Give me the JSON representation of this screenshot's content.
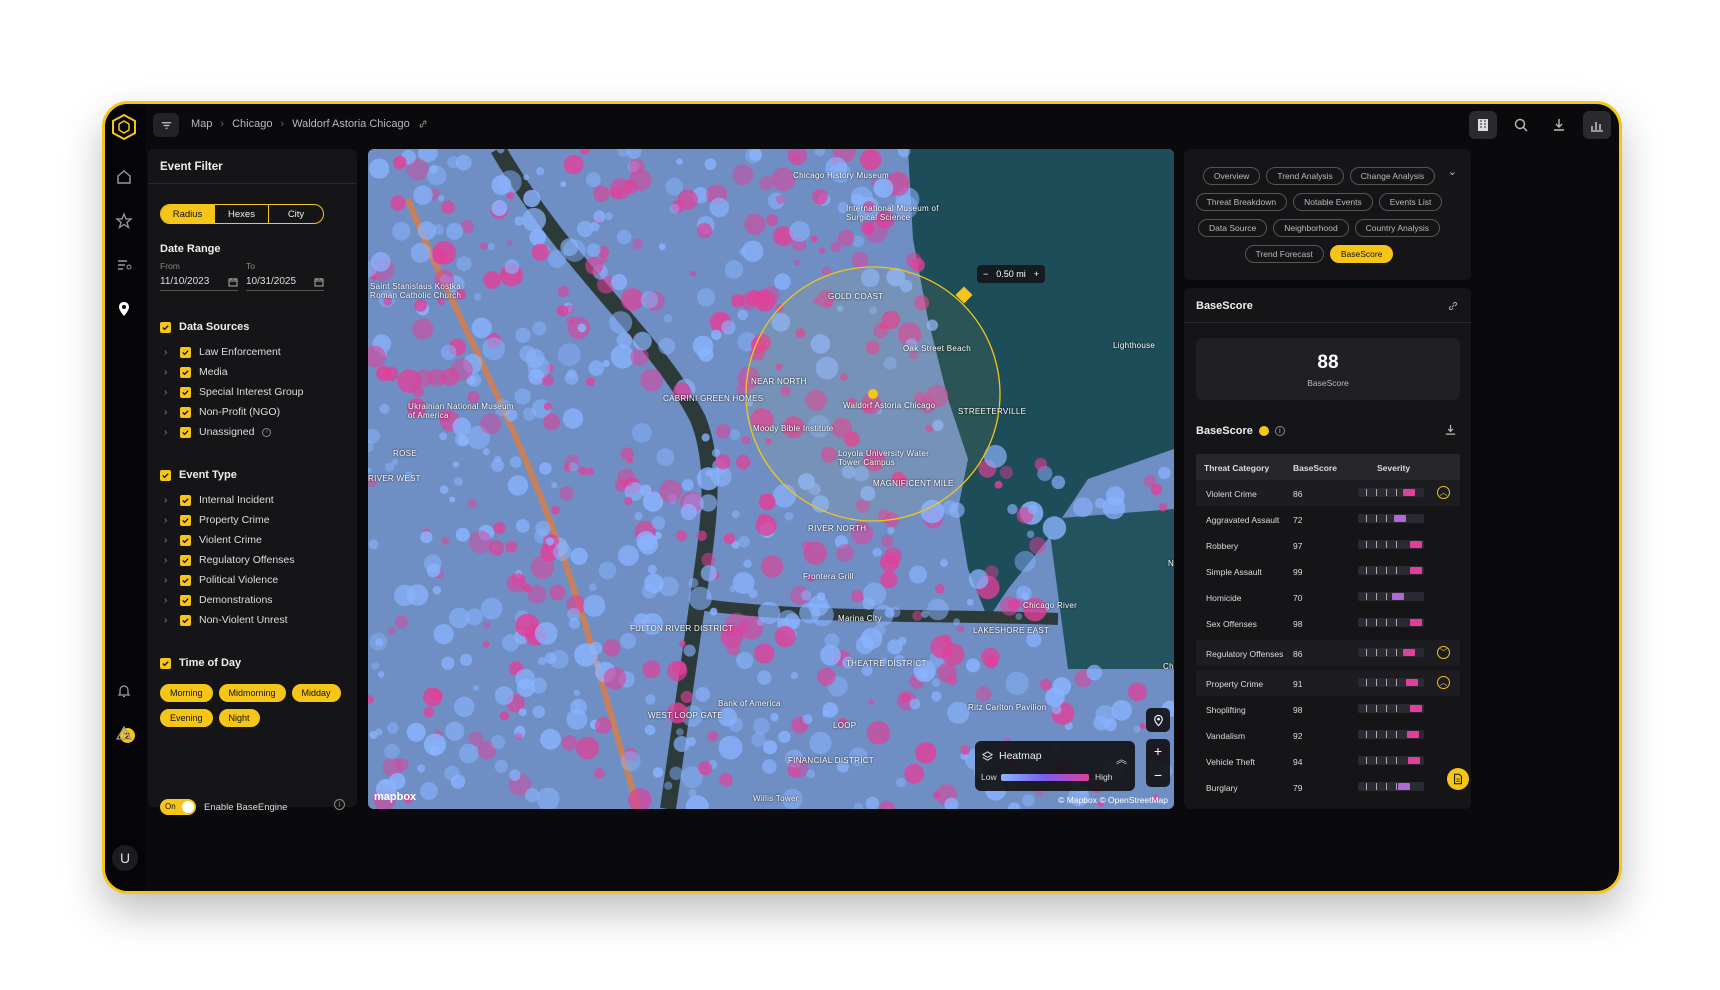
{
  "breadcrumb": [
    "Map",
    "Chicago",
    "Waldorf Astoria Chicago"
  ],
  "rail": {
    "notification_count": "2",
    "avatar_initial": "U"
  },
  "filter": {
    "title": "Event Filter",
    "modes": [
      "Radius",
      "Hexes",
      "City"
    ],
    "active_mode": "Radius",
    "date_range": {
      "title": "Date Range",
      "from_label": "From",
      "to_label": "To",
      "from": "11/10/2023",
      "to": "10/31/2025"
    },
    "data_sources": {
      "title": "Data Sources",
      "items": [
        "Law Enforcement",
        "Media",
        "Special Interest Group",
        "Non-Profit (NGO)",
        "Unassigned"
      ]
    },
    "event_type": {
      "title": "Event Type",
      "items": [
        "Internal Incident",
        "Property Crime",
        "Violent Crime",
        "Regulatory Offenses",
        "Political Violence",
        "Demonstrations",
        "Non-Violent Unrest"
      ]
    },
    "time_of_day": {
      "title": "Time of Day",
      "items": [
        "Morning",
        "Midmorning",
        "Midday",
        "Evening",
        "Night"
      ]
    },
    "engine": {
      "state": "On",
      "label": "Enable BaseEngine"
    }
  },
  "map": {
    "radius_label": "0.50 mi",
    "labels": [
      "Chicago History Museum",
      "International Museum of Surgical Science",
      "GOLD COAST",
      "Oak Street Beach",
      "Lighthouse",
      "NEAR NORTH",
      "Waldorf Astoria Chicago",
      "Moody Bible Institute",
      "Loyola University Water Tower Campus",
      "MAGNIFICENT MILE",
      "RIVER NORTH",
      "Frontera Grill",
      "CABRINI GREEN HOMES",
      "Marina City",
      "STREETERVILLE",
      "Chicago River",
      "LAKESHORE EAST",
      "FULTON RIVER DISTRICT",
      "WEST LOOP GATE",
      "LOOP",
      "THEATRE DISTRICT",
      "Bank of America",
      "Ritz Carlton Pavilion",
      "Navy",
      "Willis Tower",
      "FINANCIAL DISTRICT",
      "ROSE",
      "RIVER WEST",
      "Saint Stanislaus Kostka Roman Catholic Church",
      "Ukrainian National Museum of America",
      "Chi"
    ],
    "legend_title": "Heatmap",
    "legend_low": "Low",
    "legend_high": "High",
    "attribution": "© Mapbox  © OpenStreetMap",
    "brand": "mapbox",
    "colors": {
      "heat_low": "#8ab4ff",
      "heat_mid": "#7b5cf0",
      "heat_high": "#e0409a",
      "radius": "#f5c518"
    }
  },
  "analysis_tabs": {
    "items": [
      "Overview",
      "Trend Analysis",
      "Change Analysis",
      "Threat Breakdown",
      "Notable Events",
      "Events List",
      "Data Source",
      "Neighborhood",
      "Country Analysis",
      "Trend Forecast",
      "BaseScore"
    ],
    "active": "BaseScore"
  },
  "basescore": {
    "header": "BaseScore",
    "value": "88",
    "value_label": "BaseScore",
    "section_title": "BaseScore",
    "columns": [
      "Threat Category",
      "BaseScore",
      "Severity"
    ],
    "rows": [
      {
        "name": "Violent Crime",
        "score": "86",
        "parent": true,
        "expanded": true,
        "level": "high"
      },
      {
        "name": "Aggravated Assault",
        "score": "72",
        "parent": false,
        "level": "mid"
      },
      {
        "name": "Robbery",
        "score": "97",
        "parent": false,
        "level": "high"
      },
      {
        "name": "Simple Assault",
        "score": "99",
        "parent": false,
        "level": "high"
      },
      {
        "name": "Homicide",
        "score": "70",
        "parent": false,
        "level": "mid"
      },
      {
        "name": "Sex Offenses",
        "score": "98",
        "parent": false,
        "level": "high"
      },
      {
        "name": "Regulatory Offenses",
        "score": "86",
        "parent": true,
        "expanded": false,
        "level": "high"
      },
      {
        "name": "Property Crime",
        "score": "91",
        "parent": true,
        "expanded": true,
        "level": "high"
      },
      {
        "name": "Shoplifting",
        "score": "98",
        "parent": false,
        "level": "high"
      },
      {
        "name": "Vandalism",
        "score": "92",
        "parent": false,
        "level": "high"
      },
      {
        "name": "Vehicle Theft",
        "score": "94",
        "parent": false,
        "level": "high"
      },
      {
        "name": "Burglary",
        "score": "79",
        "parent": false,
        "level": "mid"
      }
    ],
    "severity_colors": {
      "high": "#e0409a",
      "mid": "#b06ad8"
    }
  }
}
